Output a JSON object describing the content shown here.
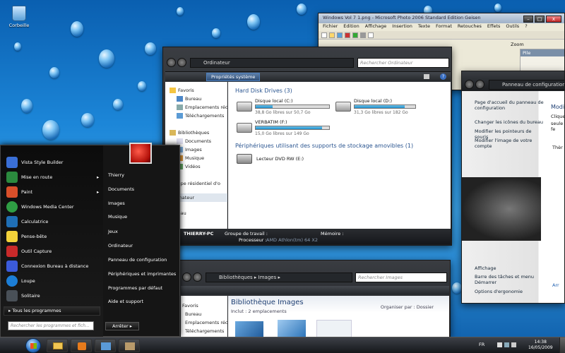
{
  "desktop": {
    "recycle_label": "Corbeille"
  },
  "photo_window": {
    "title": "Windows Vol 7 1.png - Microsoft Photo 2006 Standard Edition Geisen",
    "menu": [
      "Fichier",
      "Edition",
      "Affichage",
      "Insertion",
      "Texte",
      "Format",
      "Retouches",
      "Effets",
      "Outils",
      "?"
    ],
    "zoom_label": "Zoom",
    "layer_label": "Pile"
  },
  "explorer": {
    "breadcrumb": "Ordinateur",
    "search_placeholder": "Rechercher Ordinateur",
    "toolbar_button": "Propriétés système",
    "nav": {
      "favorites": "Favoris",
      "fav_items": [
        "Bureau",
        "Emplacements récents",
        "Téléchargements"
      ],
      "libraries": "Bibliothèques",
      "lib_items": [
        "Documents",
        "Images",
        "Musique",
        "Vidéos"
      ],
      "homegroup": "Groupe résidentiel d'o",
      "computer": "Ordinateur",
      "network": "Réseau"
    },
    "hdd_header": "Hard Disk Drives (3)",
    "drives": [
      {
        "name": "Disque local (C:)",
        "free": "38,8 Go libres sur 50,7 Go",
        "used_fraction": 0.23
      },
      {
        "name": "Disque local (D:)",
        "free": "31,3 Go libres sur 182 Go",
        "used_fraction": 0.83
      },
      {
        "name": "VERBATIM (F:)",
        "free": "15,0 Go libres sur 149 Go",
        "used_fraction": 0.9
      }
    ],
    "removable_header": "Périphériques utilisant des supports de stockage amovibles (1)",
    "dvd": "Lecteur DVD RW (E:)",
    "details": {
      "pc": "THIERRY-PC",
      "group_label": "Groupe de travail :",
      "memory_label": "Mémoire :",
      "cpu_label": "Processeur :",
      "cpu": "AMD Athlon(tm) 64 X2"
    }
  },
  "library_window": {
    "breadcrumb": "Bibliothèques ▸ Images ▸",
    "search_placeholder": "Rechercher Images",
    "title": "Bibliothèque Images",
    "include": "Inclut : 2 emplacements",
    "arrange": "Organiser par : Dossier",
    "nav": [
      "Favoris",
      "Bureau",
      "Emplacements récents",
      "Téléchargements"
    ]
  },
  "control_panel": {
    "breadcrumb": "Panneau de configuration",
    "links": [
      "Page d'accueil du panneau de configuration",
      "Changer les icônes du bureau",
      "Modifier les pointeurs de souris",
      "Modifier l'image de votre compte"
    ],
    "see_also": [
      "Affichage",
      "Barre des tâches et menu Démarrer",
      "Options d'ergonomie"
    ],
    "right_texts": [
      "Modi",
      "Cliquez",
      "seule fe",
      "Thèr",
      "Arr"
    ]
  },
  "start_menu": {
    "left_items": [
      "Vista Style Builder",
      "Mise en route",
      "Paint",
      "Windows Media Center",
      "Calculatrice",
      "Pense-bête",
      "Outil Capture",
      "Connexion Bureau à distance",
      "Loupe",
      "Solitaire"
    ],
    "all_programs": "Tous les programmes",
    "search_placeholder": "Rechercher les programmes et fich...",
    "right_items": [
      "Thierry",
      "Documents",
      "Images",
      "Musique",
      "Jeux",
      "Ordinateur",
      "Panneau de configuration",
      "Périphériques et imprimantes",
      "Programmes par défaut",
      "Aide et support"
    ],
    "shutdown": "Arrêter",
    "item_colors": [
      "#3a6fd6",
      "#2b8a3e",
      "#d94f2a",
      "#2f9e44",
      "#1f6fb5",
      "#f2d23a",
      "#c92a2a",
      "#3b5bdb",
      "#1c7ed6",
      "#495057"
    ]
  },
  "taskbar": {
    "lang": "FR",
    "time": "14:38",
    "date": "16/05/2009"
  }
}
